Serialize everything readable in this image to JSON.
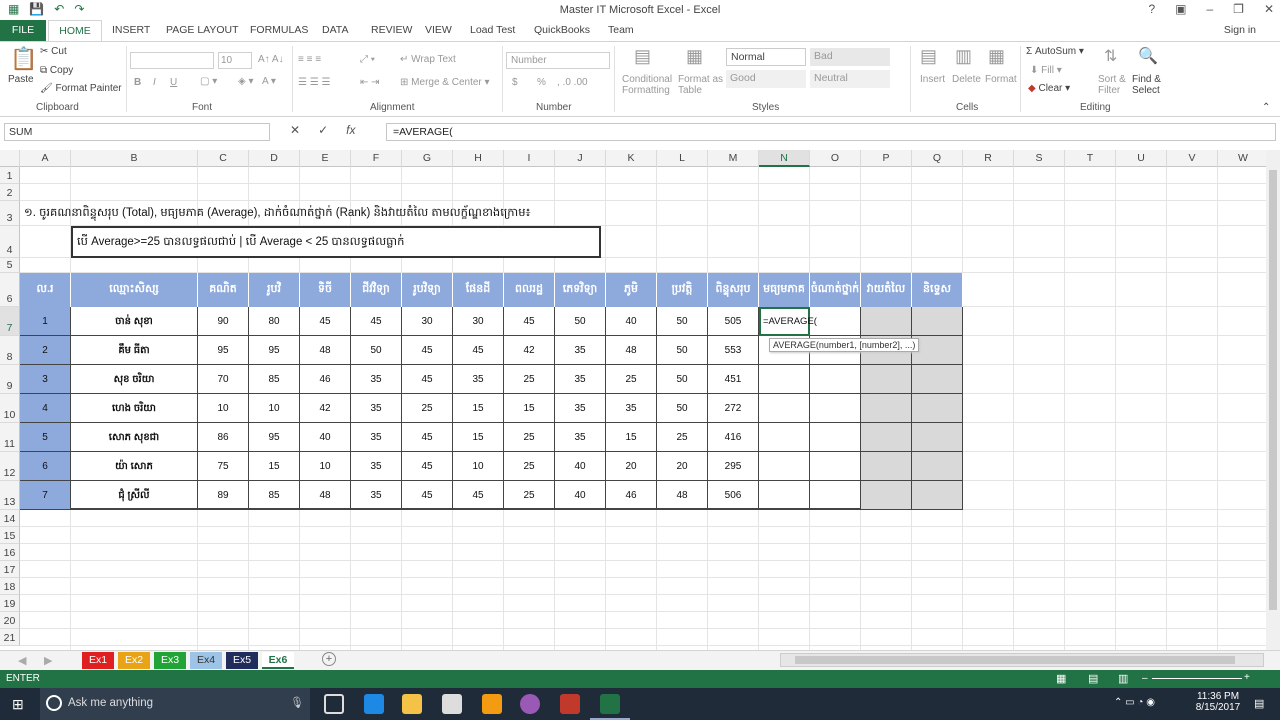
{
  "window": {
    "title": "Master IT Microsoft Excel - Excel",
    "signin": "Sign in"
  },
  "tabs": [
    "FILE",
    "HOME",
    "INSERT",
    "PAGE LAYOUT",
    "FORMULAS",
    "DATA",
    "REVIEW",
    "VIEW",
    "Load Test",
    "QuickBooks",
    "Team"
  ],
  "ribbon": {
    "clipboard": {
      "paste": "Paste",
      "cut": "Cut",
      "copy": "Copy",
      "format_painter": "Format Painter",
      "label": "Clipboard"
    },
    "font": {
      "size": "10",
      "label": "Font",
      "bold": "B",
      "italic": "I",
      "underline": "U"
    },
    "alignment": {
      "wrap": "Wrap Text",
      "merge": "Merge & Center",
      "label": "Alignment"
    },
    "number": {
      "format": "Number",
      "label": "Number",
      "currency": "$",
      "percent": "%"
    },
    "styles": {
      "cond": "Conditional",
      "cond2": "Formatting",
      "fmt_table": "Format as",
      "fmt_table2": "Table",
      "normal": "Normal",
      "bad": "Bad",
      "good": "Good",
      "neutral": "Neutral",
      "label": "Styles"
    },
    "cells": {
      "insert": "Insert",
      "delete": "Delete",
      "format": "Format",
      "label": "Cells"
    },
    "editing": {
      "autosum": "AutoSum",
      "fill": "Fill",
      "clear": "Clear",
      "sort": "Sort &",
      "sort2": "Filter",
      "find": "Find &",
      "find2": "Select",
      "label": "Editing"
    }
  },
  "formula_bar": {
    "name_box": "SUM",
    "formula": "=AVERAGE("
  },
  "columns": [
    "A",
    "B",
    "C",
    "D",
    "E",
    "F",
    "G",
    "H",
    "I",
    "J",
    "K",
    "L",
    "M",
    "N",
    "O",
    "P",
    "Q",
    "R",
    "S",
    "T",
    "U",
    "V",
    "W"
  ],
  "rows": [
    "1",
    "2",
    "3",
    "4",
    "5",
    "6",
    "7",
    "8",
    "9",
    "10",
    "11",
    "12",
    "13",
    "14",
    "15",
    "16",
    "17",
    "18",
    "19",
    "20",
    "21"
  ],
  "sheet": {
    "instruction": "១. ចូរគណនាពិន្ទុសរុប (Total), មធ្យមភាគ (Average), ដាក់ចំណាត់ថ្នាក់ (Rank) និងវាយតំលៃ តាមលក្ខ័ណ្ឌខាងក្រោម៖",
    "condition": "បើ Average>=25 បានលទ្ធផលជាប់ | បើ Average < 25 បានលទ្ធផលធ្លាក់",
    "headers": [
      "ល.រ",
      "ឈ្មោះសិស្ស",
      "គណិត",
      "រូបវិ",
      "ទិចី",
      "ជីវវិទ្យា",
      "រូបវិទ្យា",
      "ផែនដី",
      "ពលរដ្ឋ",
      "ភេទវិទ្យា",
      "ភូមិ",
      "ប្រវត្តិ",
      "ពិន្ទុសរុប",
      "មធ្យមភាគ",
      "ចំណាត់ថ្នាក់",
      "វាយតំលៃ",
      "និទ្ទេស"
    ],
    "data": [
      [
        "1",
        "ចាន់ សុខា",
        "90",
        "80",
        "45",
        "45",
        "30",
        "30",
        "45",
        "50",
        "40",
        "50",
        "505"
      ],
      [
        "2",
        "គឹម ធីតា",
        "95",
        "95",
        "48",
        "50",
        "45",
        "45",
        "42",
        "35",
        "48",
        "50",
        "553"
      ],
      [
        "3",
        "សុខ ចរិយា",
        "70",
        "85",
        "46",
        "35",
        "45",
        "35",
        "25",
        "35",
        "25",
        "50",
        "451"
      ],
      [
        "4",
        "ហេង ចរិយា",
        "10",
        "10",
        "42",
        "35",
        "25",
        "15",
        "15",
        "35",
        "35",
        "50",
        "272"
      ],
      [
        "5",
        "សោភ សុខជា",
        "86",
        "95",
        "40",
        "35",
        "45",
        "15",
        "25",
        "35",
        "15",
        "25",
        "416"
      ],
      [
        "6",
        "យ៉ា សោភ",
        "75",
        "15",
        "10",
        "35",
        "45",
        "10",
        "25",
        "40",
        "20",
        "20",
        "295"
      ],
      [
        "7",
        "ជុំ ស្រីលី",
        "89",
        "85",
        "48",
        "35",
        "45",
        "45",
        "25",
        "40",
        "46",
        "48",
        "506"
      ]
    ],
    "active_cell_text": "=AVERAGE(",
    "tooltip": "AVERAGE(number1, [number2], ...)"
  },
  "sheet_tabs": [
    {
      "label": "Ex1",
      "color": "#e02020"
    },
    {
      "label": "Ex2",
      "color": "#e8a317"
    },
    {
      "label": "Ex3",
      "color": "#21a336"
    },
    {
      "label": "Ex4",
      "color": "#9dc3e6"
    },
    {
      "label": "Ex5",
      "color": "#1f2c5c"
    },
    {
      "label": "Ex6",
      "color": "#ffffff"
    }
  ],
  "status": {
    "mode": "ENTER"
  },
  "taskbar": {
    "search": "Ask me anything",
    "time": "11:36 PM",
    "date": "8/15/2017"
  }
}
